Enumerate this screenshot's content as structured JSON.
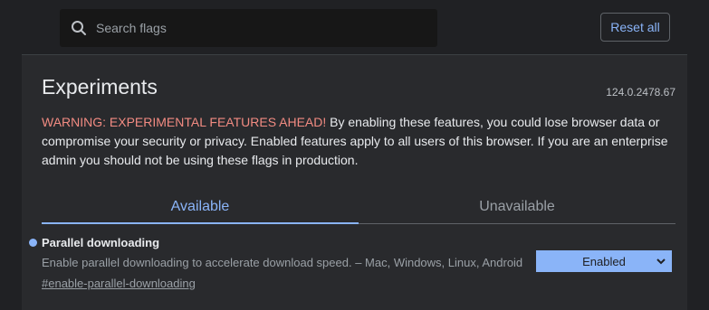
{
  "search": {
    "placeholder": "Search flags",
    "icon": "search-icon"
  },
  "toolbar": {
    "reset_label": "Reset all"
  },
  "page": {
    "title": "Experiments",
    "version": "124.0.2478.67",
    "warning_head": "WARNING: EXPERIMENTAL FEATURES AHEAD!",
    "warning_body": " By enabling these features, you could lose browser data or compromise your security or privacy. Enabled features apply to all users of this browser. If you are an enterprise admin you should not be using these flags in production."
  },
  "tabs": [
    {
      "label": "Available",
      "selected": true
    },
    {
      "label": "Unavailable",
      "selected": false
    }
  ],
  "experiment": {
    "name": "Parallel downloading",
    "description": "Enable parallel downloading to accelerate download speed. – Mac, Windows, Linux, Android",
    "link": "#enable-parallel-downloading",
    "selected_option": "Enabled"
  },
  "colors": {
    "background": "#202124",
    "panel": "#292a2d",
    "accent": "#8ab4f8",
    "warning": "#f28b82"
  }
}
